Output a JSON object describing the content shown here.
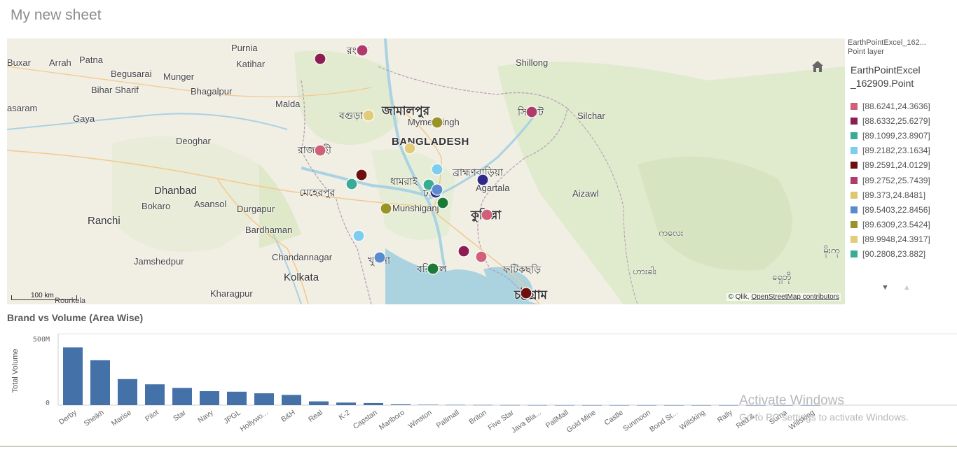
{
  "sheet": {
    "title": "My new sheet"
  },
  "map": {
    "legend": {
      "layer_name": "EarthPointExcel_162...",
      "layer_type": "Point layer",
      "title_line1": "EarthPointExcel",
      "title_line2": "_162909.Point",
      "items": [
        {
          "label": "[88.6241,24.3636]",
          "color": "#d0607a"
        },
        {
          "label": "[88.6332,25.6279]",
          "color": "#8e1c54"
        },
        {
          "label": "[89.1099,23.8907]",
          "color": "#3aab95"
        },
        {
          "label": "[89.2182,23.1634]",
          "color": "#7ecdee"
        },
        {
          "label": "[89.2591,24.0129]",
          "color": "#6b0f0f"
        },
        {
          "label": "[89.2752,25.7439]",
          "color": "#b03a6a"
        },
        {
          "label": "[89.373,24.8481]",
          "color": "#dcc872"
        },
        {
          "label": "[89.5403,22.8456]",
          "color": "#5b8bcf"
        },
        {
          "label": "[89.6309,23.5424]",
          "color": "#999329"
        },
        {
          "label": "[89.9948,24.3917]",
          "color": "#e2cc7a"
        },
        {
          "label": "[90.2808,23.882]",
          "color": "#3aab95"
        }
      ]
    },
    "attribution_prefix": "© Qlik, ",
    "attribution_link": "OpenStreetMap contributors",
    "scale_label": "100 km",
    "labels": {
      "buxar": "Buxar",
      "arrah": "Arrah",
      "patna": "Patna",
      "purnia": "Purnia",
      "katihar": "Katihar",
      "begusarai": "Begusarai",
      "munger": "Munger",
      "biharsharif": "Bihar Sharif",
      "bhagalpur": "Bhagalpur",
      "sasaram": "asaram",
      "gaya": "Gaya",
      "malda": "Malda",
      "deoghar": "Deoghar",
      "dhanbad": "Dhanbad",
      "bokaro": "Bokaro",
      "asansol": "Asansol",
      "durgapur": "Durgapur",
      "ranchi": "Ranchi",
      "bardhaman": "Bardhaman",
      "chandannagar": "Chandannagar",
      "jamshedpur": "Jamshedpur",
      "kolkata": "Kolkata",
      "kharagpur": "Kharagpur",
      "rourkela": "Rourkela",
      "shillong": "Shillong",
      "silchar": "Silchar",
      "agartala": "Agartala",
      "aizawl": "Aizawl",
      "bangladesh": "BANGLADESH",
      "rangpur": "রংপুর",
      "bogura": "বগুড়া",
      "jamalpur": "জামালপুর",
      "mymensingh": "Mymensingh",
      "rajshahi": "রাজশাহী",
      "sylhet": "সিলেট",
      "brahmanbaria": "ব্রাহ্মণবাড়িয়া",
      "dhamrai": "ধামরাই",
      "dhaka": "ঢাকা",
      "meherpur": "মেহেরপুর",
      "munshiganj": "Munshiganj",
      "cumilla": "কুমিল্লা",
      "khulna": "খুলনা",
      "barishal": "বরিশাল",
      "fatikchhari": "ফটিকছড়ি",
      "chattogram": "চট্টগ্রাম",
      "mm1": "ကလေး",
      "mm2": "ဟားခါး",
      "mm3": "မိုးကု",
      "mm4": "ရှေဘို"
    },
    "points_color_keys": "see legend"
  },
  "bar_chart": {
    "title": "Brand vs Volume (Area Wise)"
  },
  "chart_data": {
    "type": "bar",
    "title": "Brand vs Volume (Area Wise)",
    "xlabel": "",
    "ylabel": "Total Volume",
    "ylim": [
      0,
      500000000
    ],
    "ytick_labels": [
      "0",
      "500M"
    ],
    "bar_color": "#4472a8",
    "categories": [
      "Derby",
      "Sheikh",
      "Marise",
      "Pilot",
      "Star",
      "Navy",
      "JPGL",
      "Hollywo...",
      "B&H",
      "Real",
      "K-2",
      "Capstan",
      "Marlboro",
      "Winston",
      "Pallmall",
      "Briton",
      "Five Star",
      "Java Bla...",
      "PallMall",
      "Gold Mine",
      "Castle",
      "Sunmoon",
      "Bond St...",
      "Willsking",
      "Rally",
      "Red &...",
      "Surna",
      "Willsking"
    ],
    "values": [
      430000000,
      334000000,
      194000000,
      155000000,
      128000000,
      104000000,
      100000000,
      88000000,
      76000000,
      28000000,
      19000000,
      16000000,
      6000000,
      3000000,
      2000000,
      1500000,
      1000000,
      500000,
      300000,
      200000,
      150000,
      100000,
      80000,
      60000,
      40000,
      30000,
      20000,
      10000
    ]
  },
  "watermark": {
    "line1": "Activate Windows",
    "line2": "Go to PC settings to activate Windows."
  }
}
